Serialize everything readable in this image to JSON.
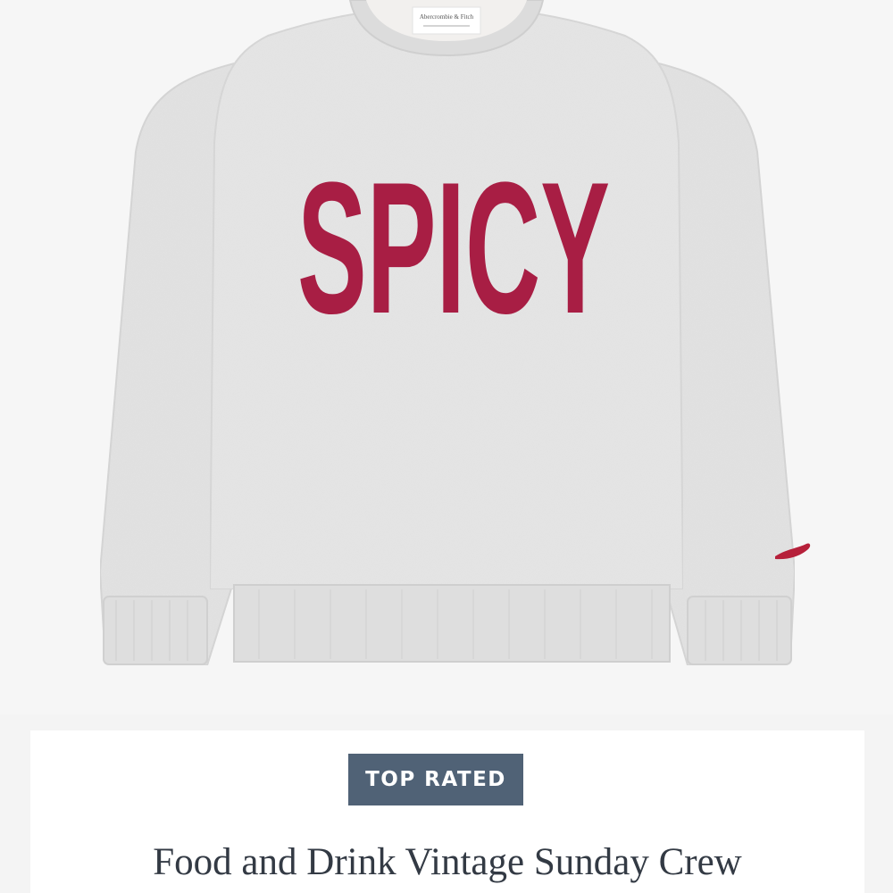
{
  "product": {
    "image": {
      "graphic_text": "SPICY",
      "tag_text": "Abercrombie & Fitch",
      "colors": {
        "fabric": "#e6e6e6",
        "print": "#a81e44",
        "background": "#f6f6f6"
      }
    },
    "badge": "TOP RATED",
    "title": "Food and Drink Vintage Sunday Crew",
    "colors": {
      "badge_bg": "#506276",
      "title_text": "#333a44"
    }
  }
}
